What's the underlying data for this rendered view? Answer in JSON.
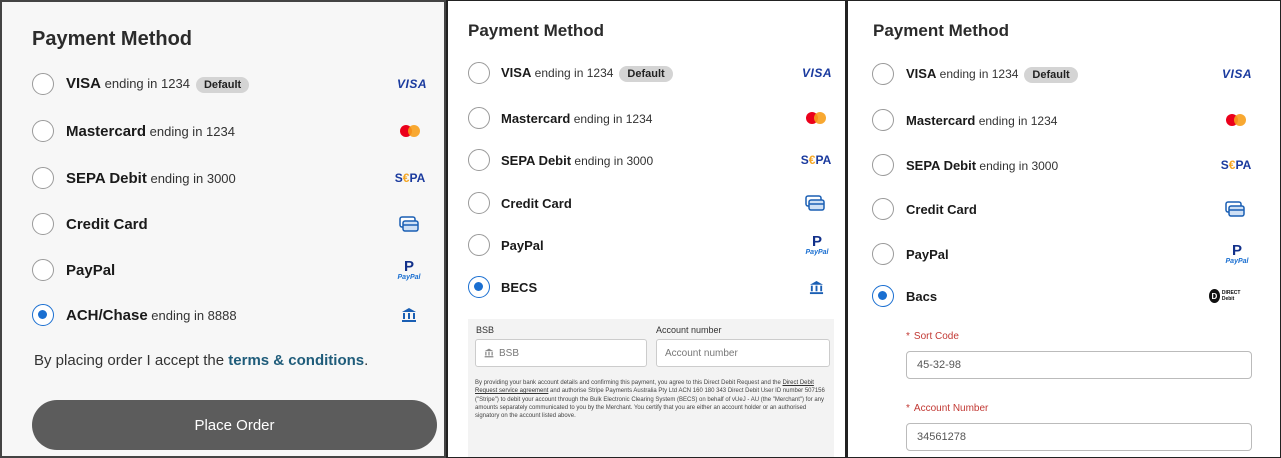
{
  "panels": {
    "p1": {
      "title": "Payment Method",
      "options": [
        {
          "brand": "VISA",
          "suffix": " ending in 1234",
          "badge": "Default",
          "icon": "visa-logo",
          "selected": false
        },
        {
          "brand": "Mastercard",
          "suffix": " ending in 1234",
          "icon": "mastercard-logo",
          "selected": false
        },
        {
          "brand": "SEPA Debit",
          "suffix": " ending in 3000",
          "icon": "sepa-logo",
          "selected": false
        },
        {
          "brand": "Credit Card",
          "suffix": "",
          "icon": "credit-card-icon",
          "selected": false
        },
        {
          "brand": "PayPal",
          "suffix": "",
          "icon": "paypal-logo",
          "selected": false
        },
        {
          "brand": "ACH/Chase",
          "suffix": " ending in 8888",
          "icon": "bank-icon",
          "selected": true
        }
      ],
      "terms_text": "By placing order I accept the ",
      "terms_link": "terms & conditions",
      "terms_end": ".",
      "place_order": "Place Order"
    },
    "p2": {
      "title": "Payment Method",
      "options": [
        {
          "brand": "VISA",
          "suffix": " ending in 1234",
          "badge": "Default"
        },
        {
          "brand": "Mastercard",
          "suffix": " ending in 1234"
        },
        {
          "brand": "SEPA Debit",
          "suffix": " ending in 3000"
        },
        {
          "brand": "Credit Card",
          "suffix": ""
        },
        {
          "brand": "PayPal",
          "suffix": ""
        },
        {
          "brand": "BECS",
          "suffix": ""
        }
      ],
      "selected_index": 5,
      "bsb_label": "BSB",
      "bsb_placeholder": "BSB",
      "account_label": "Account number",
      "account_placeholder": "Account number",
      "legal_1": "By providing your bank account details and confirming this payment, you agree to this Direct Debit Request and the ",
      "legal_link": "Direct Debit Request service agreement",
      "legal_2": " and authorise Stripe Payments Australia Pty Ltd ACN 160 180 343 Direct Debit User ID number 507156 (\"Stripe\") to debit your account through the Bulk Electronic Clearing System (BECS) on behalf of vUeJ - AU (the \"Merchant\") for any amounts separately communicated to you by the Merchant. You certify that you are either an account holder or an authorised signatory on the account listed above."
    },
    "p3": {
      "title": "Payment Method",
      "options": [
        {
          "brand": "VISA",
          "suffix": " ending in 1234",
          "badge": "Default"
        },
        {
          "brand": "Mastercard",
          "suffix": " ending in 1234"
        },
        {
          "brand": "SEPA Debit",
          "suffix": " ending in 3000"
        },
        {
          "brand": "Credit Card",
          "suffix": ""
        },
        {
          "brand": "PayPal",
          "suffix": ""
        },
        {
          "brand": "Bacs",
          "suffix": ""
        }
      ],
      "selected_index": 5,
      "sort_code_label": "Sort Code",
      "sort_code_value": "45-32-98",
      "account_number_label": "Account Number",
      "account_number_value": "34561278"
    }
  },
  "logos": {
    "visa": "VISA",
    "sepa_pre": "S",
    "sepa_mid": "€",
    "sepa_post": "PA",
    "paypal_p": "P",
    "paypal_text": "PayPal",
    "direct_debit_mark": "D",
    "direct_debit_text": "DIRECT Debit"
  },
  "colors": {
    "accent": "#1a6fd1",
    "button": "#5c5c5c",
    "link": "#1f5c7a",
    "required": "#c23934"
  }
}
